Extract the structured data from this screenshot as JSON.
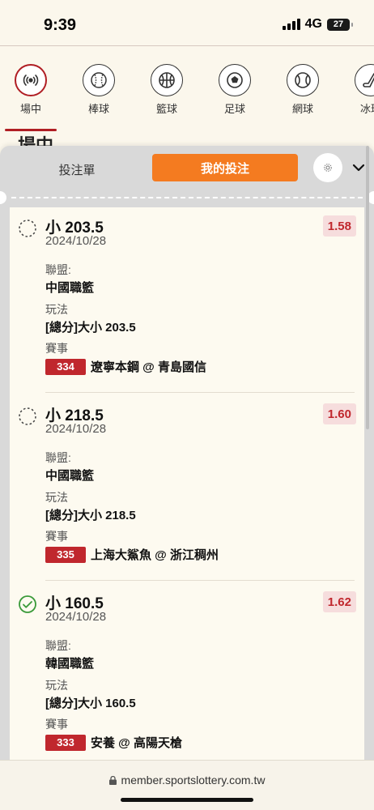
{
  "status_bar": {
    "time": "9:39",
    "network": "4G",
    "battery": "27"
  },
  "sports": [
    {
      "label": "場中",
      "icon": "live-broadcast-icon"
    },
    {
      "label": "棒球",
      "icon": "baseball-icon"
    },
    {
      "label": "籃球",
      "icon": "basketball-icon"
    },
    {
      "label": "足球",
      "icon": "soccer-ball-icon"
    },
    {
      "label": "網球",
      "icon": "tennis-ball-icon"
    },
    {
      "label": "冰球",
      "icon": "hockey-stick-icon"
    }
  ],
  "page_header": "場中",
  "sheet": {
    "tab_slip": "投注單",
    "tab_mine": "我的投注",
    "settings_icon": "gear-icon",
    "collapse_icon": "chevron-down-icon"
  },
  "labels": {
    "league": "聯盟:",
    "market": "玩法",
    "event": "賽事"
  },
  "bets": [
    {
      "status": "pending",
      "selection": "小 203.5",
      "date": "2024/10/28",
      "odds": "1.58",
      "league": "中國職籃",
      "market": "[總分]大小 203.5",
      "match_no": "334",
      "teams": "遼寧本鋼 @ 青島國信"
    },
    {
      "status": "pending",
      "selection": "小 218.5",
      "date": "2024/10/28",
      "odds": "1.60",
      "league": "中國職籃",
      "market": "[總分]大小 218.5",
      "match_no": "335",
      "teams": "上海大鯊魚 @ 浙江稠州"
    },
    {
      "status": "won",
      "selection": "小 160.5",
      "date": "2024/10/28",
      "odds": "1.62",
      "league": "韓國職籃",
      "market": "[總分]大小 160.5",
      "match_no": "333",
      "teams": "安養 @ 高陽天槍"
    }
  ],
  "footer": {
    "url": "member.sportslottery.com.tw"
  },
  "colors": {
    "accent": "#b01e24",
    "orange": "#f47b20",
    "odds_text": "#c0272d",
    "won_green": "#3a9a3a"
  }
}
